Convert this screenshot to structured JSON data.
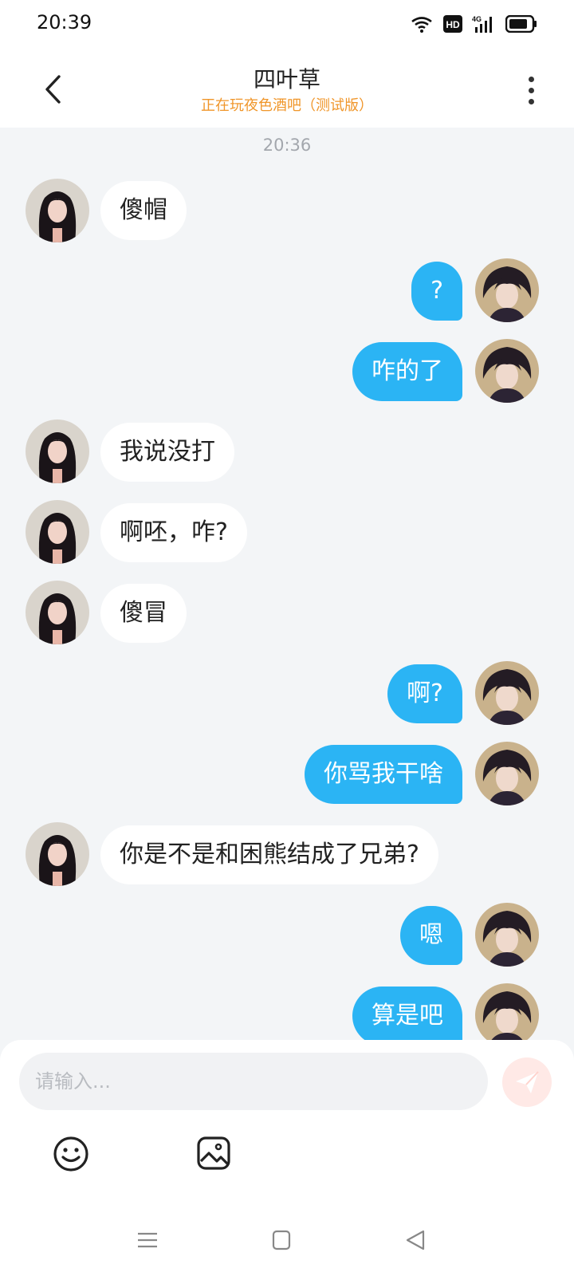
{
  "status_bar": {
    "time": "20:39",
    "icons": [
      "wifi-icon",
      "hd-icon",
      "4g-signal-icon",
      "battery-icon"
    ]
  },
  "header": {
    "title": "四叶草",
    "subtitle": "正在玩夜色酒吧（测试版）",
    "back_icon": "chevron-left-icon",
    "more_icon": "more-vertical-icon"
  },
  "chat": {
    "timestamp": "20:36",
    "messages": [
      {
        "side": "in",
        "text": "傻帽"
      },
      {
        "side": "out",
        "text": "?"
      },
      {
        "side": "out",
        "text": "咋的了"
      },
      {
        "side": "in",
        "text": "我说没打"
      },
      {
        "side": "in",
        "text": "啊呸，咋?"
      },
      {
        "side": "in",
        "text": "傻冒"
      },
      {
        "side": "out",
        "text": "啊?"
      },
      {
        "side": "out",
        "text": "你骂我干啥"
      },
      {
        "side": "in",
        "text": "你是不是和困熊结成了兄弟?"
      },
      {
        "side": "out",
        "text": "嗯"
      },
      {
        "side": "out",
        "text": "算是吧"
      }
    ]
  },
  "composer": {
    "placeholder": "请输入...",
    "send_icon": "paper-plane-icon",
    "tools": [
      "smiley-icon",
      "image-icon"
    ]
  },
  "nav_bar": {
    "items": [
      "menu-icon",
      "home-square-icon",
      "back-triangle-icon"
    ]
  },
  "colors": {
    "outgoing_bubble": "#2bb4f4",
    "incoming_bubble": "#ffffff",
    "subtitle": "#f0962a",
    "background": "#f3f5f7",
    "send_button": "#ffe9e6"
  }
}
